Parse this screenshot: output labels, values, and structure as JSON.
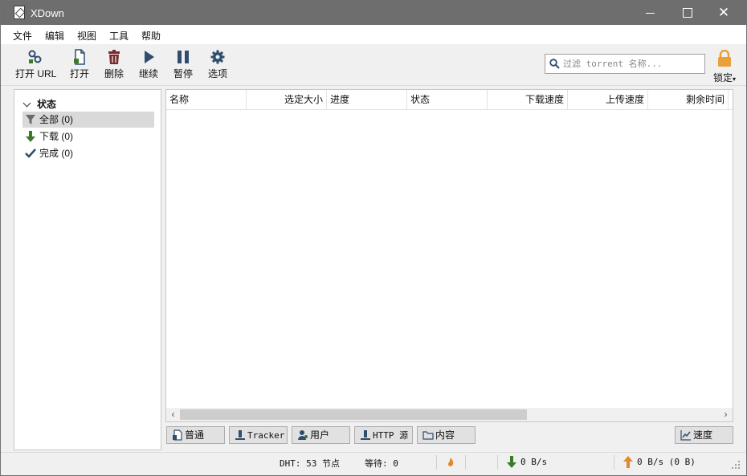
{
  "window": {
    "title": "XDown",
    "minimize_icon": "minimize-icon",
    "maximize_icon": "maximize-icon",
    "close_icon": "close-icon"
  },
  "menu": [
    "文件",
    "编辑",
    "视图",
    "工具",
    "帮助"
  ],
  "toolbar": {
    "open_url": "打开 URL",
    "open": "打开",
    "delete": "删除",
    "resume": "继续",
    "pause": "暂停",
    "options": "选项",
    "search_placeholder": "过滤 torrent 名称...",
    "lock": "锁定"
  },
  "sidebar": {
    "header": "状态",
    "items": [
      {
        "label": "全部 (0)",
        "icon": "filter-icon",
        "selected": true
      },
      {
        "label": "下载 (0)",
        "icon": "download-arrow-icon",
        "selected": false
      },
      {
        "label": "完成 (0)",
        "icon": "checkmark-icon",
        "selected": false
      }
    ]
  },
  "table": {
    "columns": [
      "名称",
      "选定大小",
      "进度",
      "状态",
      "下载速度",
      "上传速度",
      "剩余时间"
    ],
    "rows": []
  },
  "tabs": [
    "普通",
    "Tracker",
    "用户",
    "HTTP 源",
    "内容"
  ],
  "speed_button": "速度",
  "status": {
    "dht": "DHT: 53 节点",
    "waiting": "等待: 0",
    "download": "0 B/s",
    "upload": "0 B/s (0 B)"
  },
  "colors": {
    "titlebar": "#6e6e6e",
    "download_green": "#3a7a2a",
    "upload_orange": "#e08a2c",
    "lock_orange": "#e8a13a",
    "delete_red": "#7a2c2c",
    "toolbar_blue": "#2f4d6e"
  }
}
